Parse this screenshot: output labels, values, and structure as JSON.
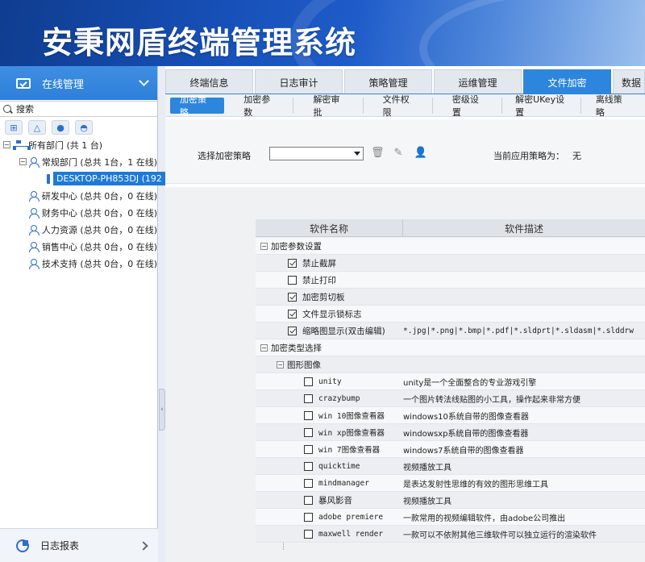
{
  "app": {
    "title": "安秉网盾终端管理系统"
  },
  "sidebar": {
    "header_label": "在线管理",
    "search_label": "搜索",
    "os_icons": [
      "windows-icon",
      "linux-icon",
      "apple-icon",
      "android-icon"
    ],
    "tree": {
      "root": "所有部门 (共 1 台)",
      "dept_main": "常规部门 (总共 1台，1 在线)",
      "device": "DESKTOP-PH853DJ (192",
      "depts": [
        "研发中心 (总共 0台，0 在线)",
        "财务中心 (总共 0台，0 在线)",
        "人力资源 (总共 0台，0 在线)",
        "销售中心 (总共 0台，0 在线)",
        "技术支持 (总共 0台，0 在线)"
      ]
    },
    "footer_label": "日志报表"
  },
  "tabs": [
    "终端信息",
    "日志审计",
    "策略管理",
    "运维管理",
    "文件加密",
    "数据"
  ],
  "subtabs": [
    "加密策略",
    "加密参数",
    "解密审批",
    "文件权限",
    "密级设置",
    "解密UKey设置",
    "离线策略"
  ],
  "policy": {
    "label": "选择加密策略",
    "selected": "",
    "current_label": "当前应用策略为：",
    "current_value": "无"
  },
  "grid": {
    "col_name": "软件名称",
    "col_desc": "软件描述",
    "group1": "加密参数设置",
    "params": [
      {
        "name": "禁止截屏",
        "checked": true,
        "desc": ""
      },
      {
        "name": "禁止打印",
        "checked": false,
        "desc": ""
      },
      {
        "name": "加密剪切板",
        "checked": true,
        "desc": ""
      },
      {
        "name": "文件显示锁标志",
        "checked": true,
        "desc": ""
      },
      {
        "name": "缩略图显示(双击编辑)",
        "checked": true,
        "desc": "*.jpg|*.png|*.bmp|*.pdf|*.sldprt|*.sldasm|*.slddrw"
      }
    ],
    "group2": "加密类型选择",
    "subgroup": "图形图像",
    "apps": [
      {
        "name": "unity",
        "desc": "unity是一个全面整合的专业游戏引擎"
      },
      {
        "name": "crazybump",
        "desc": "一个图片转法线贴图的小工具，操作起来非常方便"
      },
      {
        "name": "win 10图像查看器",
        "desc": "windows10系统自带的图像查看器"
      },
      {
        "name": "win xp图像查看器",
        "desc": "windowsxp系统自带的图像查看器"
      },
      {
        "name": "win 7图像查看器",
        "desc": "windows7系统自带的图像查看器"
      },
      {
        "name": "quicktime",
        "desc": "视频播放工具"
      },
      {
        "name": "mindmanager",
        "desc": "是表达发射性思维的有效的图形思维工具"
      },
      {
        "name": "暴风影音",
        "desc": "视频播放工具"
      },
      {
        "name": "adobe premiere",
        "desc": "一款常用的视频编辑软件，由adobe公司推出"
      },
      {
        "name": "maxwell render",
        "desc": "一款可以不依附其他三维软件可以独立运行的渲染软件"
      }
    ]
  },
  "colors": {
    "accent": "#2d86dd",
    "banner": "#1750b8",
    "selection": "#1e7ad9"
  }
}
